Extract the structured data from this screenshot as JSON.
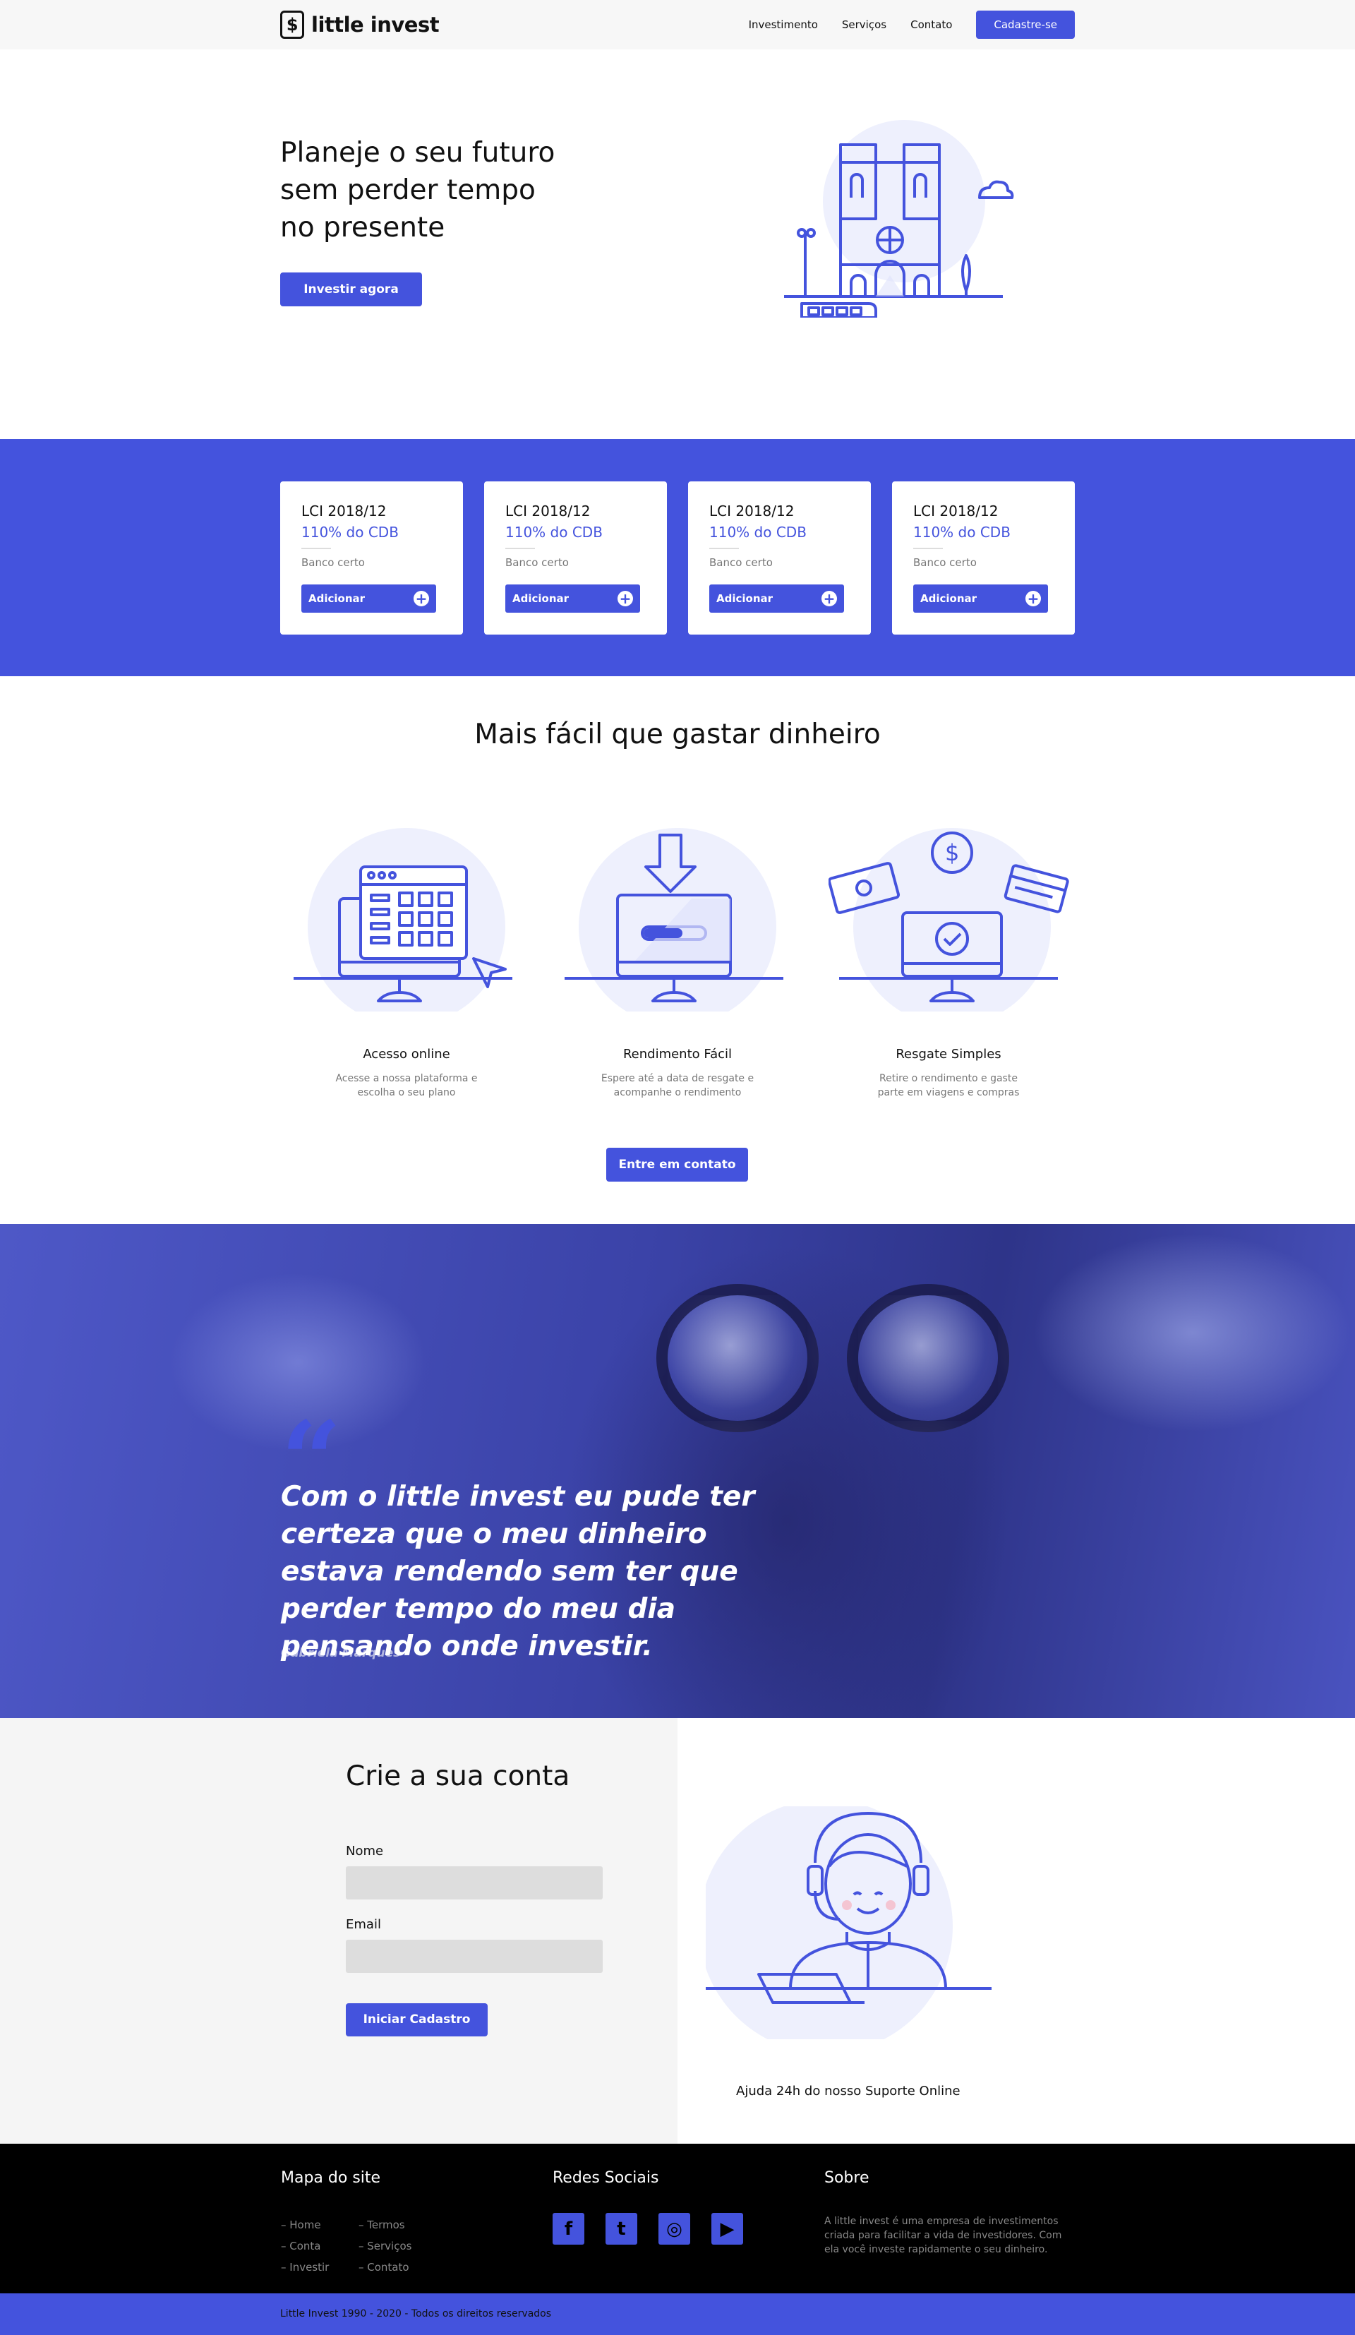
{
  "header": {
    "logo_text": "little invest",
    "logo_symbol": "$",
    "nav": [
      "Investimento",
      "Serviços",
      "Contato"
    ],
    "cta": "Cadastre-se"
  },
  "hero": {
    "title_lines": [
      "Planeje o seu futuro",
      "sem perder tempo",
      "no presente"
    ],
    "button": "Investir agora"
  },
  "cards": [
    {
      "title": "LCI 2018/12",
      "rate": "110% do CDB",
      "bank": "Banco certo",
      "button": "Adicionar"
    },
    {
      "title": "LCI 2018/12",
      "rate": "110% do CDB",
      "bank": "Banco certo",
      "button": "Adicionar"
    },
    {
      "title": "LCI 2018/12",
      "rate": "110% do CDB",
      "bank": "Banco certo",
      "button": "Adicionar"
    },
    {
      "title": "LCI 2018/12",
      "rate": "110% do CDB",
      "bank": "Banco certo",
      "button": "Adicionar"
    }
  ],
  "features": {
    "title": "Mais fácil que gastar dinheiro",
    "items": [
      {
        "title": "Acesso online",
        "desc": "Acesse a nossa plataforma e escolha o seu plano"
      },
      {
        "title": "Rendimento Fácil",
        "desc": "Espere até a data de resgate e acompanhe o rendimento"
      },
      {
        "title": "Resgate Simples",
        "desc": "Retire o rendimento e gaste parte em viagens e compras"
      }
    ],
    "button": "Entre em contato"
  },
  "testimonial": {
    "quote": "Com o little invest eu pude ter certeza que o meu dinheiro estava rendendo sem ter que perder tempo do meu dia pensando onde investir.",
    "author": "Gabriela Marques"
  },
  "signup": {
    "title": "Crie a sua conta",
    "name_label": "Nome",
    "email_label": "Email",
    "button": "Iniciar Cadastro",
    "support": "Ajuda 24h do nosso Suporte Online"
  },
  "footer": {
    "sitemap_title": "Mapa do site",
    "sitemap_col1": [
      "– Home",
      "– Conta",
      "– Investir"
    ],
    "sitemap_col2": [
      "– Termos",
      "– Serviços",
      "– Contato"
    ],
    "social_title": "Redes Sociais",
    "social_icons": [
      "facebook-icon",
      "twitter-icon",
      "instagram-icon",
      "youtube-icon"
    ],
    "about_title": "Sobre",
    "about_text": "A little invest é uma empresa de investimentos criada para facilitar a vida de investidores. Com ela você investe rapidamente o seu dinheiro.",
    "copyright": "Little Invest 1990 - 2020 - Todos os direitos reservados"
  },
  "colors": {
    "accent": "#4453dd",
    "footer_bg": "#000000",
    "header_bg": "#f7f7f7"
  }
}
